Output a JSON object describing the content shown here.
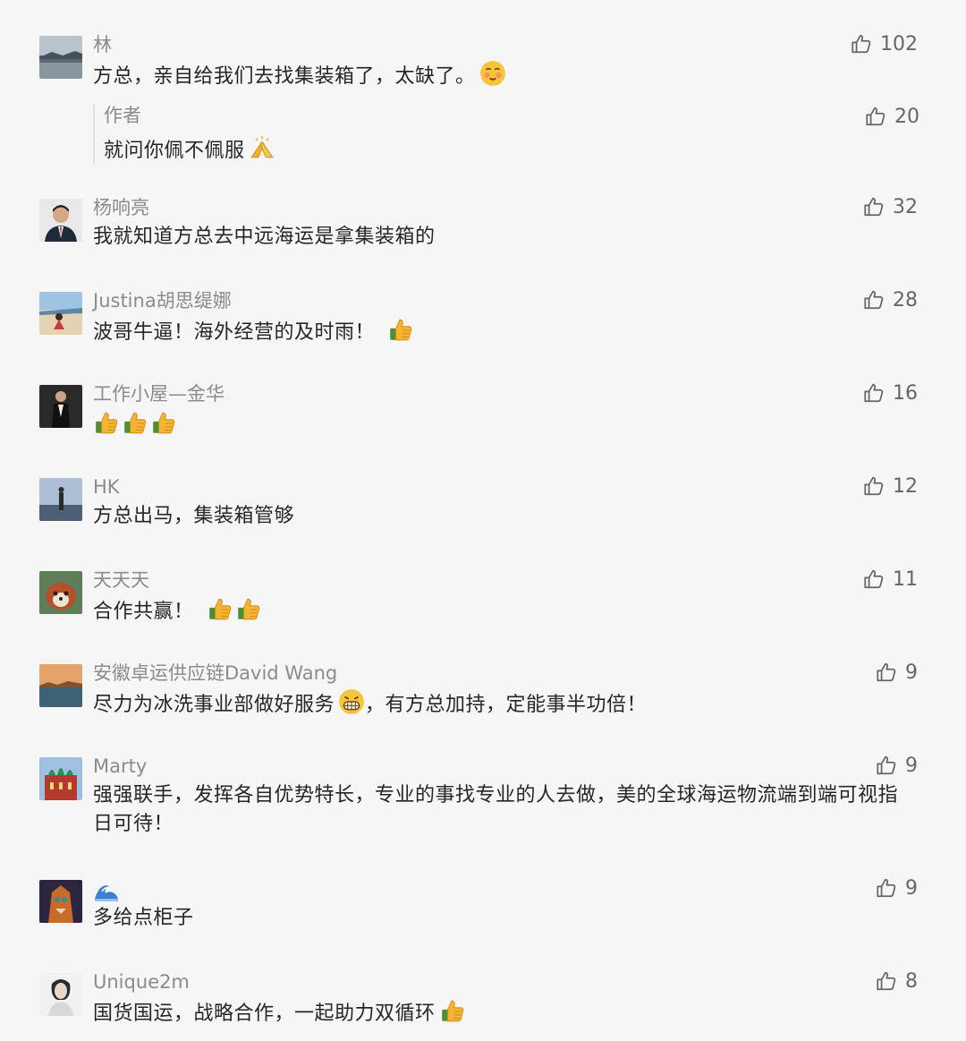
{
  "comments": [
    {
      "name": "林",
      "text": "方总，亲自给我们去找集装箱了，太缺了。",
      "likes": "102",
      "reply": {
        "name": "作者",
        "text": "就问你佩不佩服",
        "likes": "20"
      }
    },
    {
      "name": "杨响亮",
      "text": "我就知道方总去中远海运是拿集装箱的",
      "likes": "32"
    },
    {
      "name": "Justina胡思缇娜",
      "text": "波哥牛逼！海外经营的及时雨！",
      "likes": "28"
    },
    {
      "name": "工作小屋—金华",
      "text": "",
      "likes": "16"
    },
    {
      "name": "HK",
      "text": "方总出马，集装箱管够",
      "likes": "12"
    },
    {
      "name": "天天天",
      "text": "合作共赢！",
      "likes": "11"
    },
    {
      "name": "安徽卓运供应链David Wang",
      "text_a": "尽力为冰洗事业部做好服务",
      "text_b": "，有方总加持，定能事半功倍！",
      "likes": "9"
    },
    {
      "name": "Marty",
      "text": "强强联手，发挥各自优势特长，专业的事找专业的人去做，美的全球海运物流端到端可视指日可待！",
      "likes": "9"
    },
    {
      "name": "",
      "text": "多给点柜子",
      "likes": "9"
    },
    {
      "name": "Unique2m",
      "text": "国货国运，战略合作，一起助力双循环",
      "likes": "8"
    }
  ],
  "icons": {
    "like": "thumbs-up-outline-icon",
    "emoji_thumbs": "thumbs-up-emoji",
    "emoji_blush": "tongue-face-emoji",
    "emoji_grin": "grinning-face-emoji",
    "emoji_hands": "praying-hands-emoji",
    "emoji_wave": "wave-emoji"
  },
  "colors": {
    "background": "#f6f6f6",
    "name": "#8b8b8b",
    "text": "#262626",
    "like": "#666666"
  }
}
